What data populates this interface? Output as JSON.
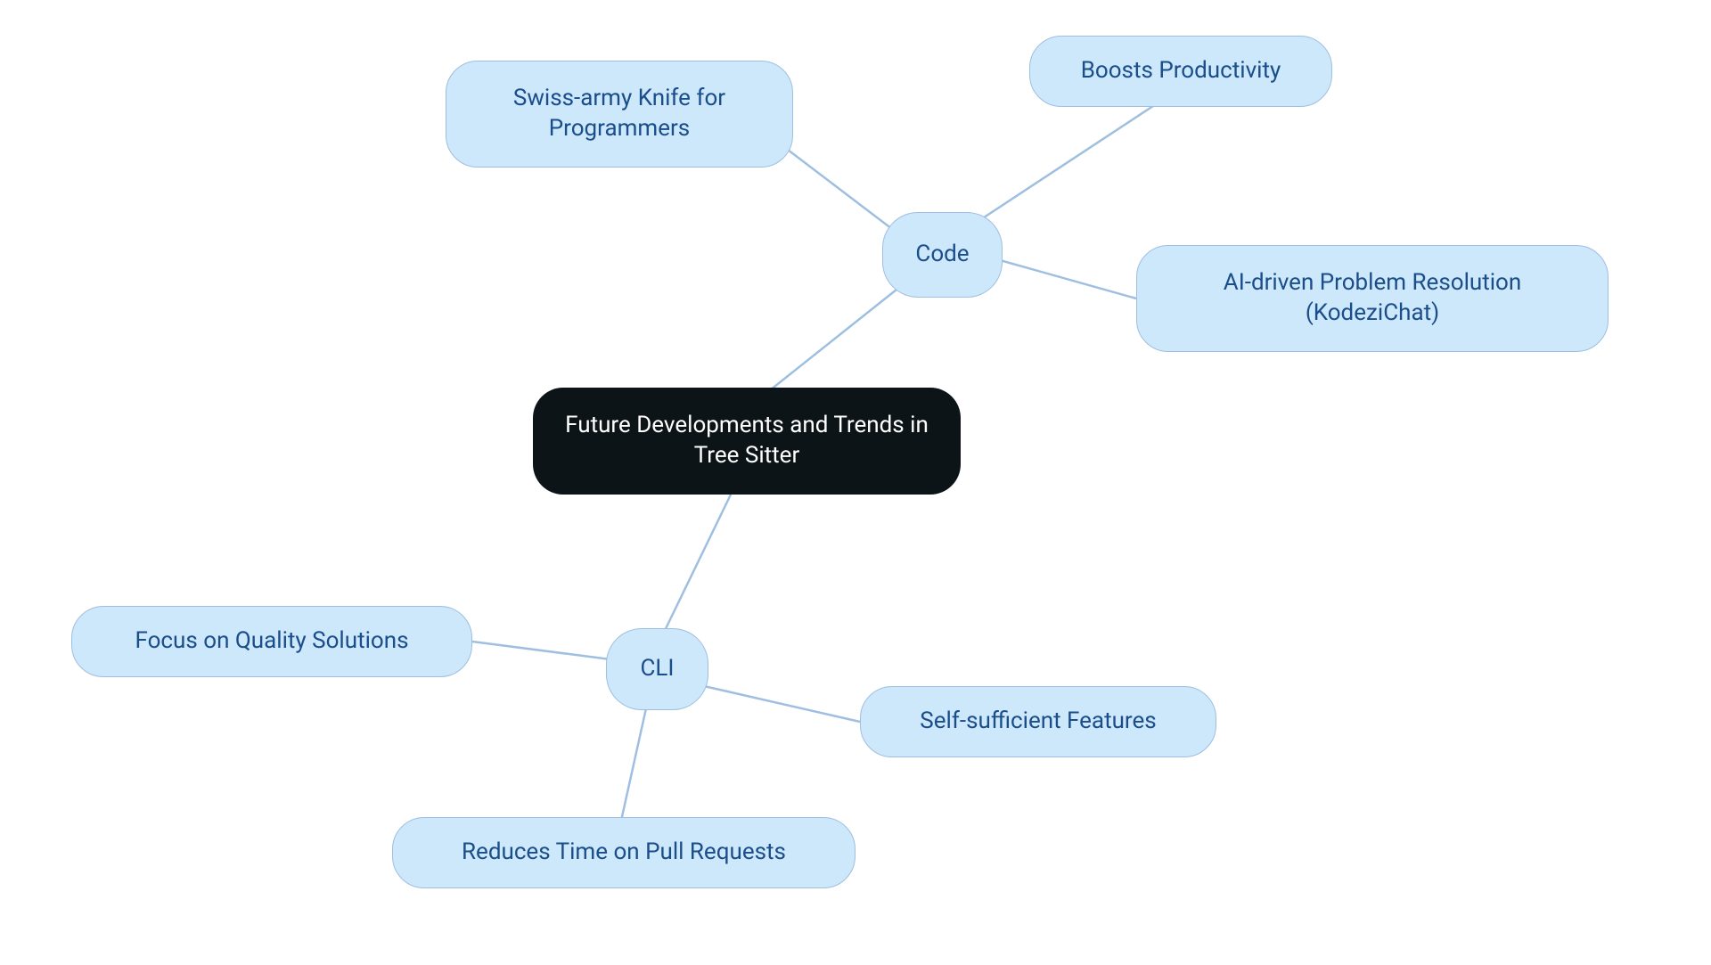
{
  "center": {
    "label": "Future Developments and Trends in Tree Sitter"
  },
  "hub": {
    "code": {
      "label": "Code"
    },
    "cli": {
      "label": "CLI"
    }
  },
  "leaf": {
    "swiss": {
      "label": "Swiss-army Knife for Programmers"
    },
    "boosts": {
      "label": "Boosts Productivity"
    },
    "ai": {
      "label": "AI-driven Problem Resolution (KodeziChat)"
    },
    "focus": {
      "label": "Focus on Quality Solutions"
    },
    "reduces": {
      "label": "Reduces Time on Pull Requests"
    },
    "self": {
      "label": "Self-sufficient Features"
    }
  },
  "colors": {
    "node_bg": "#cde7fb",
    "node_text": "#1a4e8a",
    "node_border": "#9fbfe0",
    "center_bg": "#0c1418",
    "center_text": "#ffffff",
    "edge": "#9fbfe0"
  }
}
